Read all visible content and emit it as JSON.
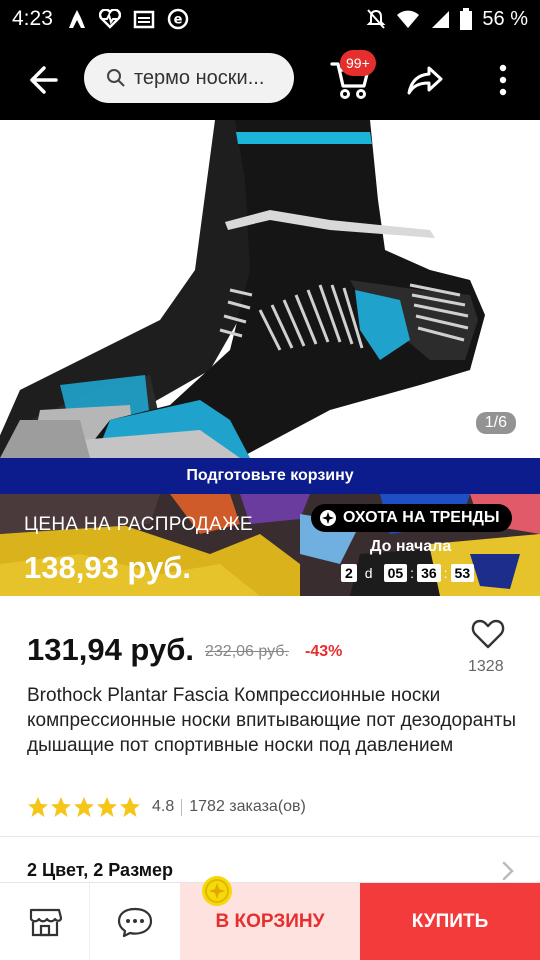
{
  "status_bar": {
    "time": "4:23",
    "battery": "56 %"
  },
  "search": {
    "placeholder_text": "термо носки..."
  },
  "cart": {
    "badge": "99+"
  },
  "gallery": {
    "pager": "1/6"
  },
  "prepare_banner": {
    "text": "Подготовьте корзину"
  },
  "sale_banner": {
    "label": "ЦЕНА НА РАСПРОДАЖЕ",
    "price": "138,93 руб.",
    "trend_label": "ОХОТА НА ТРЕНДЫ",
    "until_label": "До начала",
    "days": "2",
    "days_unit": "d",
    "hours": "05",
    "minutes": "36",
    "seconds": "53"
  },
  "product": {
    "price": "131,94 руб.",
    "old_price": "232,06 руб.",
    "discount": "-43%",
    "favorites_count": "1328",
    "title": "Brothock Plantar Fascia Компрессионные носки компрессионные носки впитывающие пот дезодоранты дышащие пот спортивные носки под давлением",
    "rating": "4.8",
    "rating_stars": 5,
    "orders": "1782 заказа(ов)",
    "variant": "2 Цвет, 2 Размер"
  },
  "bottom_bar": {
    "add_to_cart": "В КОРЗИНУ",
    "buy": "КУПИТЬ"
  },
  "colors": {
    "accent_red": "#e62e2e",
    "buy_red": "#f33b3b",
    "banner_blue": "#0c1c8c",
    "star": "#f5c518"
  }
}
